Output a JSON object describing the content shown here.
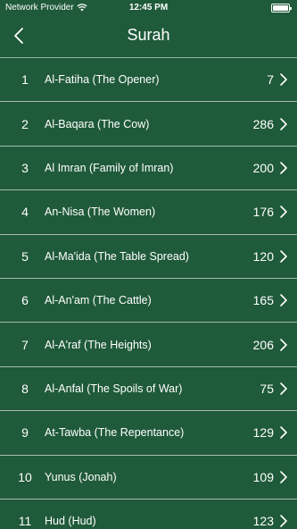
{
  "status_bar": {
    "carrier": "Network Provider",
    "time": "12:45 PM",
    "battery_level": 1.0
  },
  "nav": {
    "title": "Surah",
    "back_icon": "chevron-left-icon"
  },
  "surahs": [
    {
      "number": "1",
      "name": "Al-Fatiha (The Opener)",
      "verses": "7"
    },
    {
      "number": "2",
      "name": "Al-Baqara (The Cow)",
      "verses": "286"
    },
    {
      "number": "3",
      "name": "Al Imran (Family of Imran)",
      "verses": "200"
    },
    {
      "number": "4",
      "name": "An-Nisa (The Women)",
      "verses": "176"
    },
    {
      "number": "5",
      "name": "Al-Ma'ida (The Table Spread)",
      "verses": "120"
    },
    {
      "number": "6",
      "name": "Al-An'am (The Cattle)",
      "verses": "165"
    },
    {
      "number": "7",
      "name": "Al-A'raf (The Heights)",
      "verses": "206"
    },
    {
      "number": "8",
      "name": "Al-Anfal (The Spoils of War)",
      "verses": "75"
    },
    {
      "number": "9",
      "name": "At-Tawba (The Repentance)",
      "verses": "129"
    },
    {
      "number": "10",
      "name": "Yunus (Jonah)",
      "verses": "109"
    },
    {
      "number": "11",
      "name": "Hud (Hud)",
      "verses": "123"
    }
  ],
  "colors": {
    "background": "#1f5a3a",
    "text": "#ffffff"
  }
}
